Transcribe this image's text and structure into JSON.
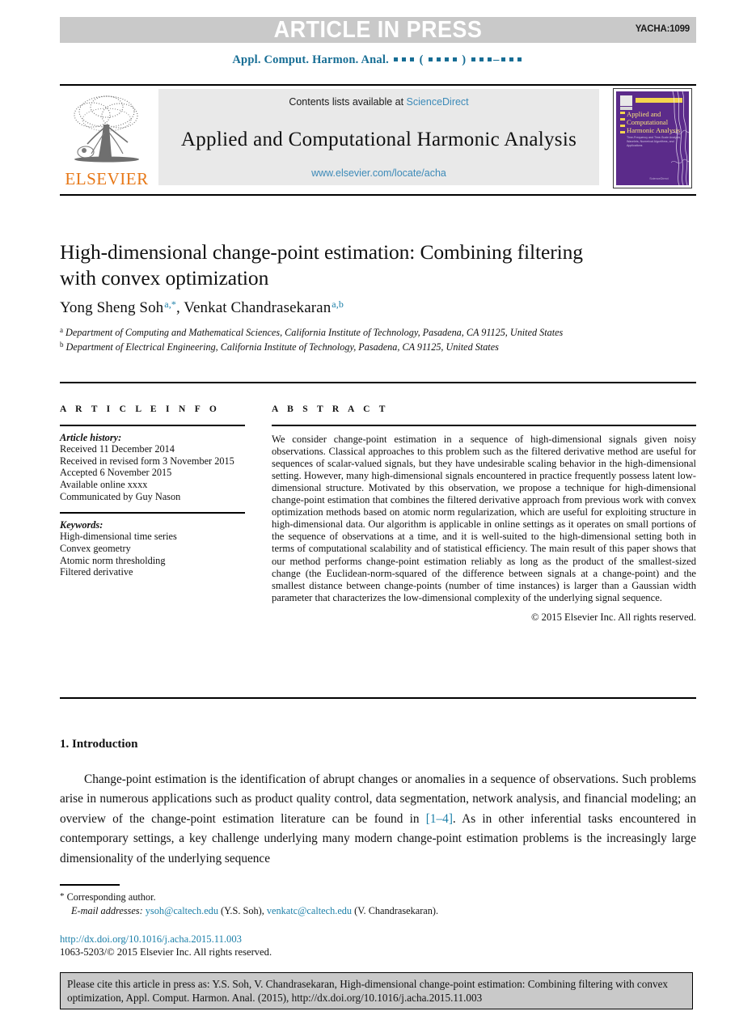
{
  "banner": {
    "label": "ARTICLE IN PRESS",
    "code": "YACHA:1099",
    "bg_color": "#c9c9c9"
  },
  "running_head": {
    "journal": "Appl. Comput. Harmon. Anal.",
    "color": "#166d94"
  },
  "masthead": {
    "contents_prefix": "Contents lists available at ",
    "sciencedirect": "ScienceDirect",
    "journal_title": "Applied and Computational Harmonic Analysis",
    "url": "www.elsevier.com/locate/acha",
    "publisher": "ELSEVIER",
    "publisher_color": "#e77817",
    "link_color": "#3c8ab8"
  },
  "cover": {
    "title": "Applied and Computational Harmonic Analysis",
    "subtitle": "Time-Frequency and Time-Scale Analysis, Wavelets, Numerical Algorithms, and Applications",
    "footer": "ScienceDirect",
    "bg_color": "#5b2b8a",
    "accent_color": "#f3d54e"
  },
  "article": {
    "title": "High-dimensional change-point estimation: Combining filtering with convex optimization",
    "authors_1": "Yong Sheng Soh",
    "authors_1_marks": "a,*",
    "authors_sep": ", ",
    "authors_2": "Venkat Chandrasekaran",
    "authors_2_marks": "a,b",
    "affiliation_a_mark": "a",
    "affiliation_a": "Department of Computing and Mathematical Sciences, California Institute of Technology, Pasadena, CA 91125, United States",
    "affiliation_b_mark": "b",
    "affiliation_b": "Department of Electrical Engineering, California Institute of Technology, Pasadena, CA 91125, United States"
  },
  "info": {
    "heading": "A R T I C L E   I N F O",
    "history_label": "Article history:",
    "history": [
      "Received 11 December 2014",
      "Received in revised form 3 November 2015",
      "Accepted 6 November 2015",
      "Available online xxxx",
      "Communicated by Guy Nason"
    ],
    "keywords_label": "Keywords:",
    "keywords": [
      "High-dimensional time series",
      "Convex geometry",
      "Atomic norm thresholding",
      "Filtered derivative"
    ]
  },
  "abstract": {
    "heading": "A B S T R A C T",
    "text": "We consider change-point estimation in a sequence of high-dimensional signals given noisy observations. Classical approaches to this problem such as the filtered derivative method are useful for sequences of scalar-valued signals, but they have undesirable scaling behavior in the high-dimensional setting. However, many high-dimensional signals encountered in practice frequently possess latent low-dimensional structure. Motivated by this observation, we propose a technique for high-dimensional change-point estimation that combines the filtered derivative approach from previous work with convex optimization methods based on atomic norm regularization, which are useful for exploiting structure in high-dimensional data. Our algorithm is applicable in online settings as it operates on small portions of the sequence of observations at a time, and it is well-suited to the high-dimensional setting both in terms of computational scalability and of statistical efficiency. The main result of this paper shows that our method performs change-point estimation reliably as long as the product of the smallest-sized change (the Euclidean-norm-squared of the difference between signals at a change-point) and the smallest distance between change-points (number of time instances) is larger than a Gaussian width parameter that characterizes the low-dimensional complexity of the underlying signal sequence.",
    "copyright": "© 2015 Elsevier Inc. All rights reserved."
  },
  "introduction": {
    "heading": "1.  Introduction",
    "para_pre": "Change-point estimation is the identification of abrupt changes or anomalies in a sequence of observations. Such problems arise in numerous applications such as product quality control, data segmentation, network analysis, and financial modeling; an overview of the change-point estimation literature can be found in ",
    "citation": "[1–4]",
    "para_post": ". As in other inferential tasks encountered in contemporary settings, a key challenge underlying many modern change-point estimation problems is the increasingly large dimensionality of the underlying sequence"
  },
  "footnotes": {
    "corresponding_star": "*",
    "corresponding": "Corresponding author.",
    "email_label": "E-mail addresses:",
    "email_1": "ysoh@caltech.edu",
    "email_1_owner": " (Y.S. Soh), ",
    "email_2": "venkatc@caltech.edu",
    "email_2_owner": " (V. Chandrasekaran).",
    "doi": "http://dx.doi.org/10.1016/j.acha.2015.11.003",
    "issn_line": "1063-5203/© 2015 Elsevier Inc. All rights reserved.",
    "link_color": "#1b7fa8"
  },
  "cite_box": {
    "text": "Please cite this article in press as: Y.S. Soh, V. Chandrasekaran, High-dimensional change-point estimation: Combining filtering with convex optimization, Appl. Comput. Harmon. Anal. (2015), http://dx.doi.org/10.1016/j.acha.2015.11.003",
    "bg_color": "#c9c9c9"
  }
}
